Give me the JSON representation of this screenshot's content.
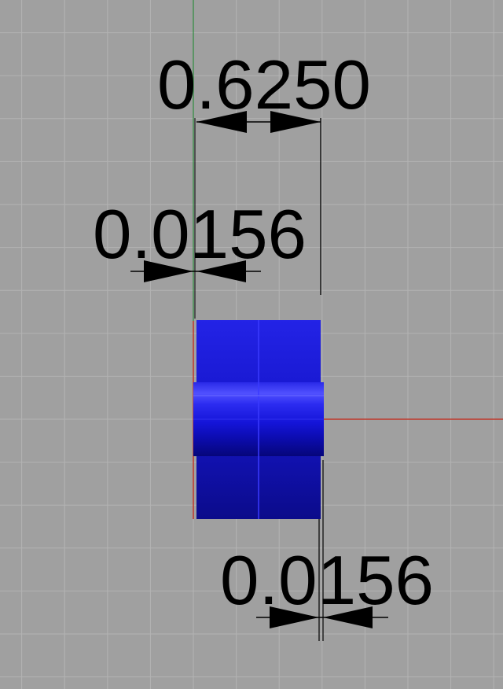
{
  "viewport": {
    "background": "#a0a0a0",
    "grid_color": "#b3b3b3",
    "axis_x_color": "#c0392b",
    "axis_y_color": "#2e8b3e",
    "part_color": "#1a1aee",
    "dimension_color": "#000000"
  },
  "dimensions": {
    "overall_width": "0.6250",
    "left_offset": "0.0156",
    "right_offset": "0.0156"
  }
}
